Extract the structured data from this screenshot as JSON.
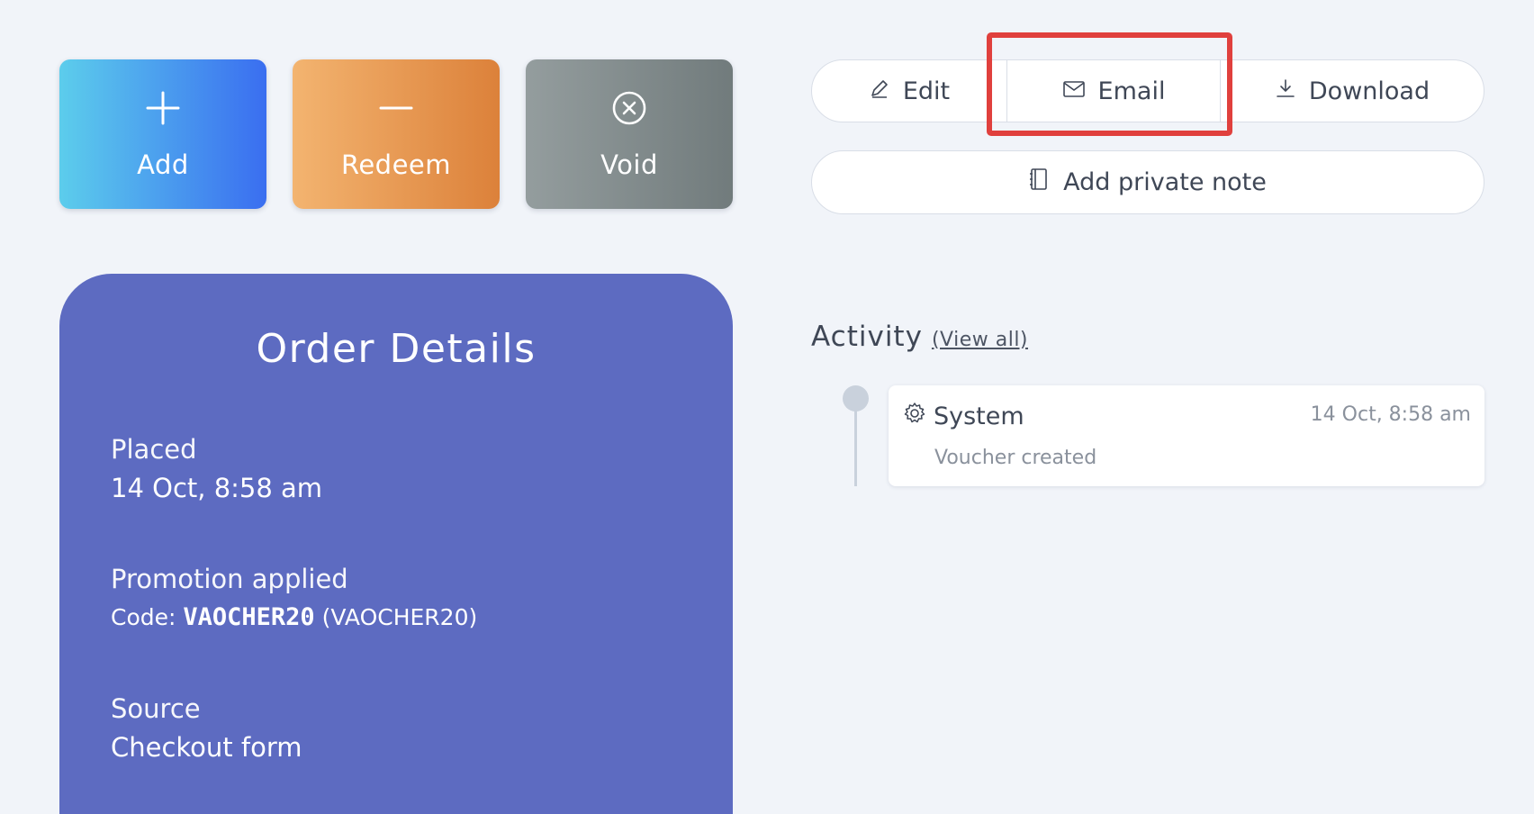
{
  "tiles": {
    "add_label": "Add",
    "redeem_label": "Redeem",
    "void_label": "Void"
  },
  "toolbar": {
    "edit_label": "Edit",
    "email_label": "Email",
    "download_label": "Download",
    "note_label": "Add private note"
  },
  "order": {
    "title": "Order Details",
    "placed_label": "Placed",
    "placed_value": "14 Oct, 8:58 am",
    "promotion_label": "Promotion applied",
    "code_prefix": "Code:",
    "code_value": "VAOCHER20",
    "code_name": "(VAOCHER20)",
    "source_label": "Source",
    "source_value": "Checkout form"
  },
  "activity": {
    "heading": "Activity",
    "view_all": "(View all)",
    "items": [
      {
        "actor": "System",
        "time": "14 Oct, 8:58 am",
        "description": "Voucher created"
      }
    ]
  },
  "colors": {
    "background": "#f1f4f9",
    "card": "#5d6bc1",
    "highlight": "#e0403d"
  }
}
